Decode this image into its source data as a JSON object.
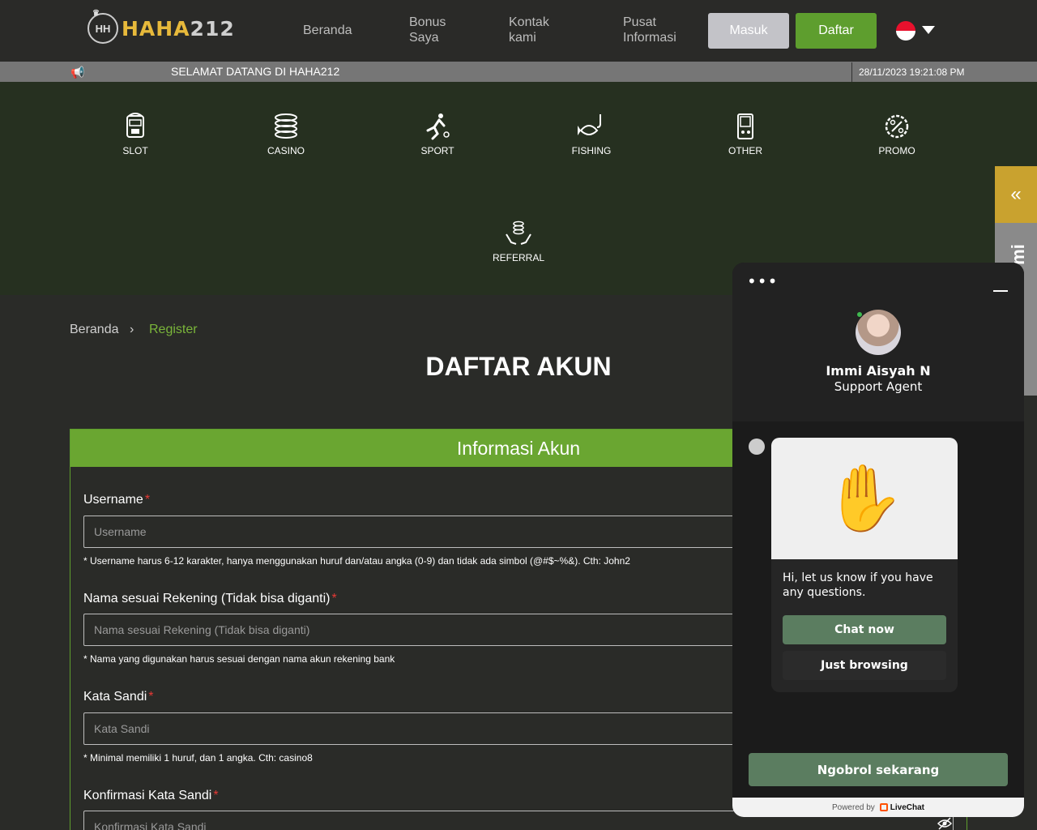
{
  "header": {
    "logo_text_gold": "HAHA",
    "logo_text_silver": "212",
    "logo_badge": "HH",
    "nav": [
      {
        "label": "Beranda"
      },
      {
        "label": "Bonus\nSaya"
      },
      {
        "label": "Kontak\nkami"
      },
      {
        "label": "Pusat\nInformasi"
      }
    ],
    "login_label": "Masuk",
    "register_label": "Daftar",
    "language_flag": "indonesia-flag-icon"
  },
  "marquee": {
    "text": "SELAMAT DATANG DI HAHA212",
    "datetime": "28/11/2023 19:21:08 PM"
  },
  "categories": [
    {
      "label": "SLOT",
      "icon": "slot-machine-icon"
    },
    {
      "label": "CASINO",
      "icon": "casino-chips-icon"
    },
    {
      "label": "SPORT",
      "icon": "soccer-player-icon"
    },
    {
      "label": "FISHING",
      "icon": "fish-hook-icon"
    },
    {
      "label": "OTHER",
      "icon": "handheld-game-icon"
    },
    {
      "label": "PROMO",
      "icon": "promo-percent-icon"
    },
    {
      "label": "REFERRAL",
      "icon": "referral-coins-hand-icon"
    }
  ],
  "breadcrumb": {
    "home": "Beranda",
    "separator": "›",
    "current": "Register"
  },
  "page_title": "DAFTAR AKUN",
  "form": {
    "section_title": "Informasi Akun",
    "fields": [
      {
        "label": "Username",
        "placeholder": "Username",
        "hint": "* Username harus 6-12 karakter, hanya menggunakan huruf dan/atau angka (0-9) dan tidak ada simbol (@#$~%&). Cth: John2"
      },
      {
        "label": "Nama sesuai Rekening (Tidak bisa diganti)",
        "placeholder": "Nama sesuai Rekening (Tidak bisa diganti)",
        "hint": "* Nama yang digunakan harus sesuai dengan nama akun rekening bank"
      },
      {
        "label": "Kata Sandi",
        "placeholder": "Kata Sandi",
        "hint": "* Minimal memiliki 1 huruf, dan 1 angka. Cth: casino8"
      },
      {
        "label": "Konfirmasi Kata Sandi",
        "placeholder": "Konfirmasi Kata Sandi",
        "hint": ""
      }
    ],
    "required_mark": "*"
  },
  "side_tab": {
    "arrow": "«",
    "text": "mi"
  },
  "chat": {
    "menu_dots": "•••",
    "agent_name": "Immi Aisyah N",
    "agent_role": "Support Agent",
    "message_emoji": "✋",
    "message_text": "Hi, let us know if you have any questions.",
    "chat_now_label": "Chat now",
    "just_browsing_label": "Just browsing",
    "start_chat_label": "Ngobrol sekarang",
    "powered_by": "Powered by",
    "powered_brand": "LiveChat"
  },
  "colors": {
    "accent_green": "#6aa631",
    "button_green": "#5e9e2e",
    "category_bg": "#263020",
    "chat_button": "#5b7d60",
    "gold": "#e7b93b"
  }
}
